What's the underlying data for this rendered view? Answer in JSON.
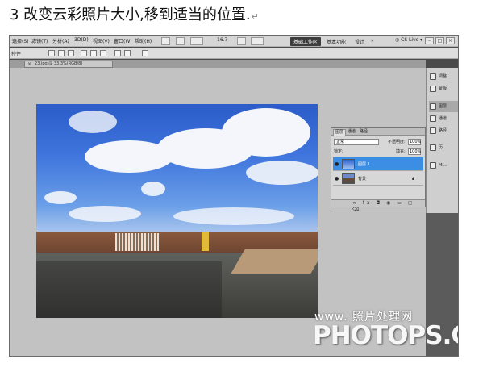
{
  "heading": {
    "text": "3 改变云彩照片大小,移到适当的位置.",
    "return_mark": "↵"
  },
  "menubar": {
    "items": [
      "选择(S)",
      "滤镜(T)",
      "分析(A)",
      "3D(D)",
      "视图(V)",
      "窗口(W)",
      "帮助(H)"
    ],
    "zoom": "16.7",
    "workspace_active": "基础工作区",
    "workspace_links": [
      "基本功能",
      "设计",
      "»"
    ],
    "cs_live": "CS Live",
    "window_controls": [
      "–",
      "□",
      "×"
    ]
  },
  "options_bar": {
    "label": "控件"
  },
  "document_tab": {
    "close": "×",
    "title": "23.jpg @ 33.3%(RGB/8)"
  },
  "layers_panel": {
    "tabs": [
      "图层",
      "通道",
      "路径"
    ],
    "blend_mode": "正常",
    "opacity_label": "不透明度:",
    "opacity_value": "100%",
    "lock_label": "锁定:",
    "fill_label": "填充:",
    "fill_value": "100%",
    "layers": [
      {
        "name": "图层 1",
        "selected": true
      },
      {
        "name": "背景",
        "selected": false
      }
    ],
    "footer_icons": "∞ fx ◘ ◉ ▭ ▢ ⌫"
  },
  "dock": {
    "items": [
      "调整",
      "蒙版",
      "图层",
      "通道",
      "路径",
      "历...",
      "Mi..."
    ],
    "active": "图层"
  },
  "watermark": {
    "top": "www.  照片处理网",
    "main": "PHOTOPS.COM"
  }
}
